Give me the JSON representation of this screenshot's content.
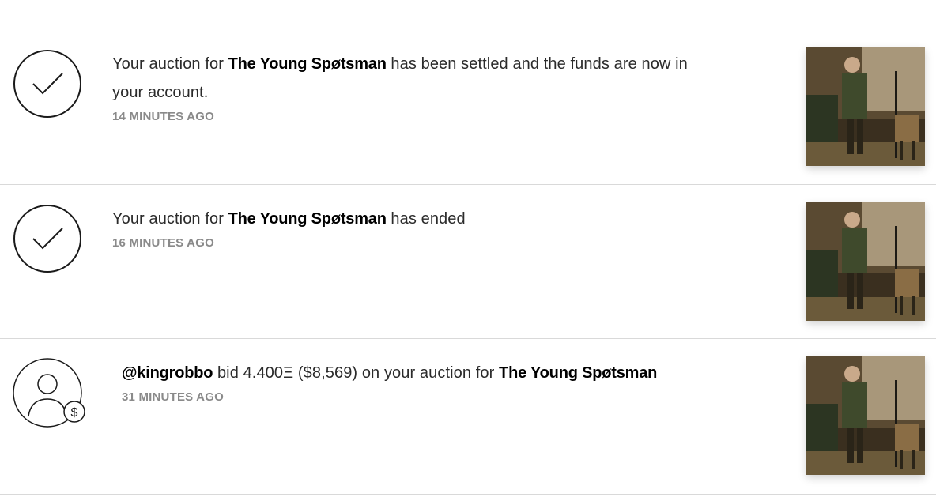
{
  "notifications": [
    {
      "type": "settled",
      "icon": "check-circle-icon",
      "prefix": "Your auction for ",
      "artwork": "The Young Spøtsman",
      "suffix": " has been settled and the funds are now in your account.",
      "time": "14 MINUTES AGO"
    },
    {
      "type": "ended",
      "icon": "check-circle-icon",
      "prefix": "Your auction for ",
      "artwork": "The Young Spøtsman",
      "suffix": " has ended",
      "time": "16 MINUTES AGO"
    },
    {
      "type": "bid",
      "icon": "user-bid-icon",
      "user": "@kingrobbo",
      "bid_text": " bid 4.400Ξ ($8,569) on your auction for ",
      "artwork": "The Young Spøtsman",
      "time": "31 MINUTES AGO"
    }
  ],
  "colors": {
    "text": "#2b2b2b",
    "bold": "#000000",
    "muted": "#8a8a8a",
    "divider": "#d9d9d9"
  }
}
